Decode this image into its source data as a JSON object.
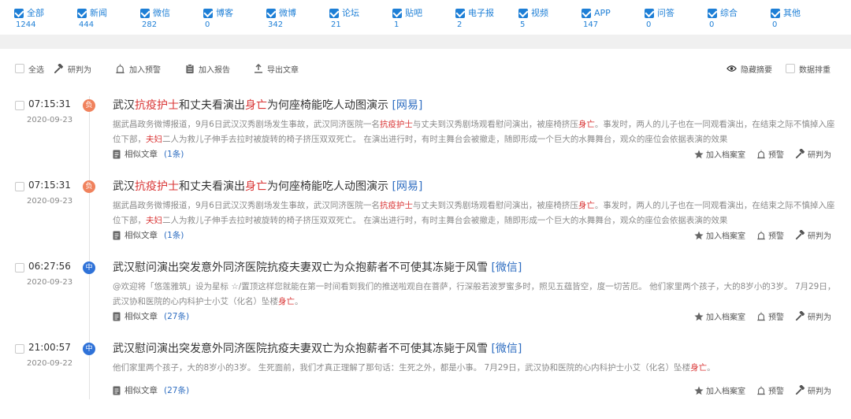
{
  "categories": [
    {
      "label": "全部",
      "count": "1244",
      "checked": true
    },
    {
      "label": "新闻",
      "count": "444",
      "checked": true
    },
    {
      "label": "微信",
      "count": "282",
      "checked": true
    },
    {
      "label": "博客",
      "count": "0",
      "checked": true
    },
    {
      "label": "微博",
      "count": "342",
      "checked": true
    },
    {
      "label": "论坛",
      "count": "21",
      "checked": true
    },
    {
      "label": "贴吧",
      "count": "1",
      "checked": true
    },
    {
      "label": "电子报",
      "count": "2",
      "checked": true
    },
    {
      "label": "视频",
      "count": "5",
      "checked": true
    },
    {
      "label": "APP",
      "count": "147",
      "checked": true
    },
    {
      "label": "问答",
      "count": "0",
      "checked": true
    },
    {
      "label": "综合",
      "count": "0",
      "checked": true
    },
    {
      "label": "其他",
      "count": "0",
      "checked": true
    }
  ],
  "toolbar": {
    "select_all": "全选",
    "judge": "研判为",
    "add_warning": "加入预警",
    "add_report": "加入报告",
    "export": "导出文章",
    "hide_summary": "隐藏摘要",
    "data_sort": "数据排重"
  },
  "items": [
    {
      "time": "07:15:31",
      "date": "2020-09-23",
      "badge": "负",
      "badge_color": "#f0825d",
      "title_parts": [
        {
          "t": "武汉"
        },
        {
          "t": "抗疫护士",
          "hl": true
        },
        {
          "t": "和丈夫看演出"
        },
        {
          "t": "身亡",
          "hl": true
        },
        {
          "t": "为何座椅能吃人动图演示 "
        },
        {
          "t": "[网易]",
          "src": true
        }
      ],
      "summary_parts": [
        {
          "t": "据武昌政务微博报道，9月6日武汉汉秀剧场发生事故，武汉同济医院一名"
        },
        {
          "t": "抗疫护士",
          "hl": true
        },
        {
          "t": "与丈夫到汉秀剧场观看慰问演出，被座椅挤压"
        },
        {
          "t": "身亡",
          "hl": true
        },
        {
          "t": "。事发时，两人的儿子也在一同观看演出，在结束之际不慎掉入座位下部，"
        },
        {
          "t": "夫妇",
          "hl": true
        },
        {
          "t": "二人为救儿子伸手去拉时被旋转的椅子挤压双双死亡。 在演出进行时，有时主舞台会被撤走，随即形成一个巨大的水舞舞台，观众的座位会依据表演的效果"
        }
      ],
      "similar_label": "相似文章",
      "similar_count": "(1条)"
    },
    {
      "time": "07:15:31",
      "date": "2020-09-23",
      "badge": "负",
      "badge_color": "#f0825d",
      "title_parts": [
        {
          "t": "武汉"
        },
        {
          "t": "抗疫护士",
          "hl": true
        },
        {
          "t": "和丈夫看演出"
        },
        {
          "t": "身亡",
          "hl": true
        },
        {
          "t": "为何座椅能吃人动图演示 "
        },
        {
          "t": "[网易]",
          "src": true
        }
      ],
      "summary_parts": [
        {
          "t": "据武昌政务微博报道，9月6日武汉汉秀剧场发生事故，武汉同济医院一名"
        },
        {
          "t": "抗疫护士",
          "hl": true
        },
        {
          "t": "与丈夫到汉秀剧场观看慰问演出，被座椅挤压"
        },
        {
          "t": "身亡",
          "hl": true
        },
        {
          "t": "。事发时，两人的儿子也在一同观看演出，在结束之际不慎掉入座位下部，"
        },
        {
          "t": "夫妇",
          "hl": true
        },
        {
          "t": "二人为救儿子伸手去拉时被旋转的椅子挤压双双死亡。 在演出进行时，有时主舞台会被撤走，随即形成一个巨大的水舞舞台，观众的座位会依据表演的效果"
        }
      ],
      "similar_label": "相似文章",
      "similar_count": "(1条)"
    },
    {
      "time": "06:27:56",
      "date": "2020-09-23",
      "badge": "中",
      "badge_color": "#2f72d8",
      "title_parts": [
        {
          "t": "武汉慰问演出突发意外同济医院抗疫夫妻双亡为众抱薪者不可使其冻毙于风雪 "
        },
        {
          "t": "[微信]",
          "src": true
        }
      ],
      "summary_parts": [
        {
          "t": "@欢迎将「悠莲雅筑」设为星标 ☆/置顶这样您就能在第一时间看到我们的推送啦观自在菩萨，行深般若波罗蜜多时，照见五蕴皆空，度一切苦厄。 他们家里两个孩子，大的8岁小的3岁。 7月29日，武汉协和医院的心内科护士小艾（化名）坠楼"
        },
        {
          "t": "身亡",
          "hl": true
        },
        {
          "t": "。"
        }
      ],
      "similar_label": "相似文章",
      "similar_count": "(27条)"
    },
    {
      "time": "21:00:57",
      "date": "2020-09-22",
      "badge": "中",
      "badge_color": "#2f72d8",
      "title_parts": [
        {
          "t": "武汉慰问演出突发意外同济医院抗疫夫妻双亡为众抱薪者不可使其冻毙于风雪 "
        },
        {
          "t": "[微信]",
          "src": true
        }
      ],
      "summary_parts": [
        {
          "t": "他们家里两个孩子，大的8岁小的3岁。 生死面前，我们才真正理解了那句话：生死之外，都是小事。 7月29日，武汉协和医院的心内科护士小艾（化名）坠楼"
        },
        {
          "t": "身亡",
          "hl": true
        },
        {
          "t": "。"
        }
      ],
      "similar_label": "相似文章",
      "similar_count": "(27条)"
    }
  ],
  "actions": {
    "archive": "加入档案室",
    "warning": "预警",
    "judge": "研判为"
  },
  "icons": {
    "check": "checkmark-icon",
    "hammer": "hammer-icon",
    "bell": "alarm-icon",
    "report": "clipboard-icon",
    "export": "upload-icon",
    "eye": "eye-icon",
    "doc": "document-icon",
    "star": "star-icon"
  }
}
